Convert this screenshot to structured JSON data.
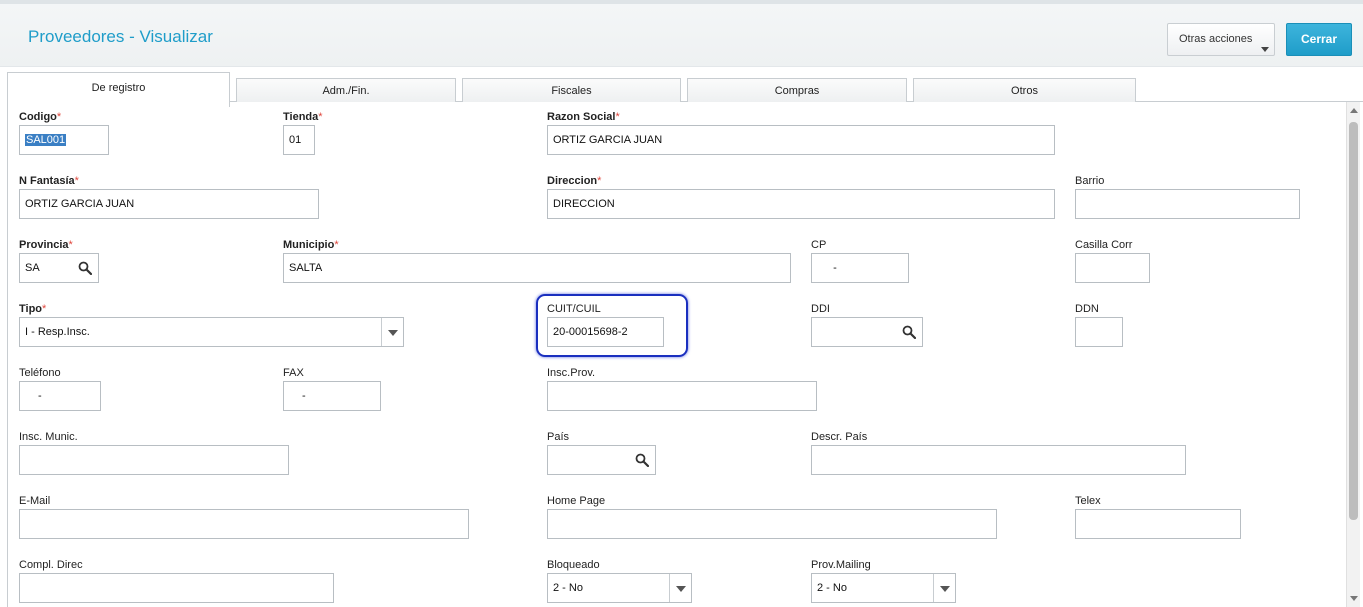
{
  "header": {
    "title": "Proveedores - Visualizar",
    "otras_acciones": "Otras acciones",
    "cerrar": "Cerrar"
  },
  "tabs": [
    {
      "label": "De registro",
      "active": true
    },
    {
      "label": "Adm./Fin.",
      "active": false
    },
    {
      "label": "Fiscales",
      "active": false
    },
    {
      "label": "Compras",
      "active": false
    },
    {
      "label": "Otros",
      "active": false
    }
  ],
  "form": {
    "codigo": {
      "label": "Codigo",
      "value": "SAL001",
      "required": true
    },
    "tienda": {
      "label": "Tienda",
      "value": "01",
      "required": true
    },
    "razon_social": {
      "label": "Razon Social",
      "value": "ORTIZ GARCIA JUAN",
      "required": true
    },
    "n_fantasia": {
      "label": "N Fantasía",
      "value": "ORTIZ GARCIA JUAN",
      "required": true
    },
    "direccion": {
      "label": "Direccion",
      "value": "DIRECCION",
      "required": true
    },
    "barrio": {
      "label": "Barrio",
      "value": ""
    },
    "provincia": {
      "label": "Provincia",
      "value": "SA",
      "required": true
    },
    "municipio": {
      "label": "Municipio",
      "value": "SALTA",
      "required": true
    },
    "cp": {
      "label": "CP",
      "value": "-"
    },
    "casilla_corr": {
      "label": "Casilla Corr",
      "value": ""
    },
    "tipo": {
      "label": "Tipo",
      "value": "I - Resp.Insc.",
      "required": true
    },
    "cuit_cuil": {
      "label": "CUIT/CUIL",
      "value": "20-00015698-2"
    },
    "ddi": {
      "label": "DDI",
      "value": ""
    },
    "ddn": {
      "label": "DDN",
      "value": ""
    },
    "telefono": {
      "label": "Teléfono",
      "value": "-"
    },
    "fax": {
      "label": "FAX",
      "value": "-"
    },
    "insc_prov": {
      "label": "Insc.Prov.",
      "value": ""
    },
    "insc_munic": {
      "label": "Insc. Munic.",
      "value": ""
    },
    "pais": {
      "label": "País",
      "value": ""
    },
    "descr_pais": {
      "label": "Descr. País",
      "value": ""
    },
    "email": {
      "label": "E-Mail",
      "value": ""
    },
    "home_page": {
      "label": "Home Page",
      "value": ""
    },
    "telex": {
      "label": "Telex",
      "value": ""
    },
    "compl_direc": {
      "label": "Compl. Direc",
      "value": ""
    },
    "bloqueado": {
      "label": "Bloqueado",
      "value": "2 - No"
    },
    "prov_mailing": {
      "label": "Prov.Mailing",
      "value": "2 - No"
    }
  },
  "icons": {
    "search": "magnifier-icon",
    "dropdown": "chevron-down-icon"
  },
  "colors": {
    "title": "#1f9dc9",
    "primary_button": "#1f9dc9",
    "required_star": "#e0463c",
    "highlight_border": "#1a2fbf"
  }
}
